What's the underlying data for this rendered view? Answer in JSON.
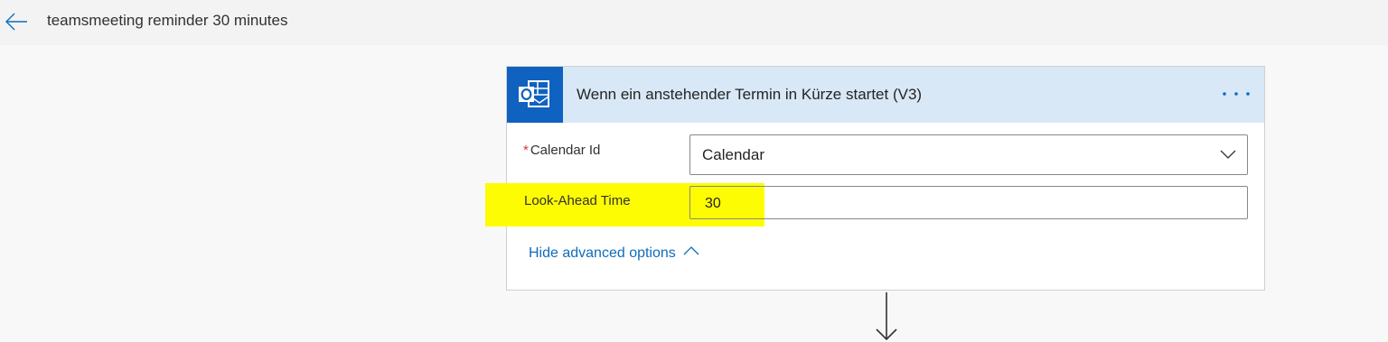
{
  "header": {
    "back_icon": "arrow-left-icon",
    "title": "teamsmeeting reminder 30 minutes"
  },
  "trigger_card": {
    "icon": "outlook-icon",
    "title": "Wenn ein anstehender Termin in Kürze startet (V3)",
    "more_icon": "ellipsis-icon",
    "fields": {
      "calendar_id": {
        "label": "Calendar Id",
        "required_marker": "*",
        "value": "Calendar"
      },
      "look_ahead_time": {
        "label": "Look-Ahead Time",
        "value": "30"
      }
    },
    "advanced_toggle_label": "Hide advanced options"
  },
  "colors": {
    "accent": "#0f62bf",
    "header_background": "#d8e8f7",
    "highlight": "#fdfc03",
    "link": "#0f6cbd",
    "required": "#d13438"
  }
}
